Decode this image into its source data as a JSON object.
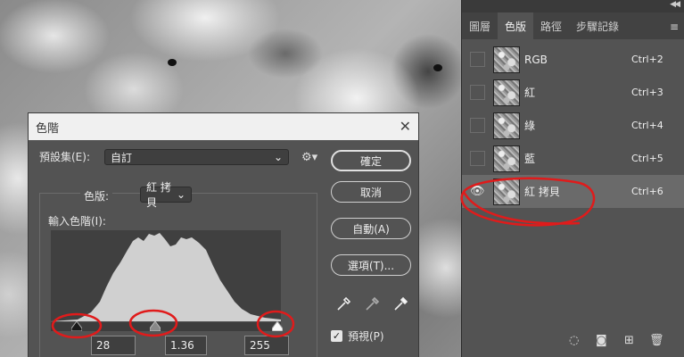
{
  "dialog": {
    "title": "色階",
    "preset_label": "預設集(E):",
    "preset_value": "自訂",
    "channel_label": "色版:",
    "channel_value": "紅 拷貝",
    "input_levels_label": "輸入色階(I):",
    "input_black": "28",
    "input_gamma": "1.36",
    "input_white": "255",
    "buttons": {
      "ok": "確定",
      "cancel": "取消",
      "auto": "自動(A)",
      "options": "選項(T)..."
    },
    "preview_label": "預視(P)",
    "preview_checked": true
  },
  "panel": {
    "tabs": [
      "圖層",
      "色版",
      "路徑",
      "步驟記錄"
    ],
    "active_tab": "色版",
    "channels": [
      {
        "name": "RGB",
        "shortcut": "Ctrl+2",
        "visible": false,
        "selected": false
      },
      {
        "name": "紅",
        "shortcut": "Ctrl+3",
        "visible": false,
        "selected": false
      },
      {
        "name": "綠",
        "shortcut": "Ctrl+4",
        "visible": false,
        "selected": false
      },
      {
        "name": "藍",
        "shortcut": "Ctrl+5",
        "visible": false,
        "selected": false
      },
      {
        "name": "紅 拷貝",
        "shortcut": "Ctrl+6",
        "visible": true,
        "selected": true
      }
    ]
  },
  "colors": {
    "annotation": "#e01b1b",
    "dialog_bg": "#535353",
    "panel_selected": "#6a6a6a"
  }
}
